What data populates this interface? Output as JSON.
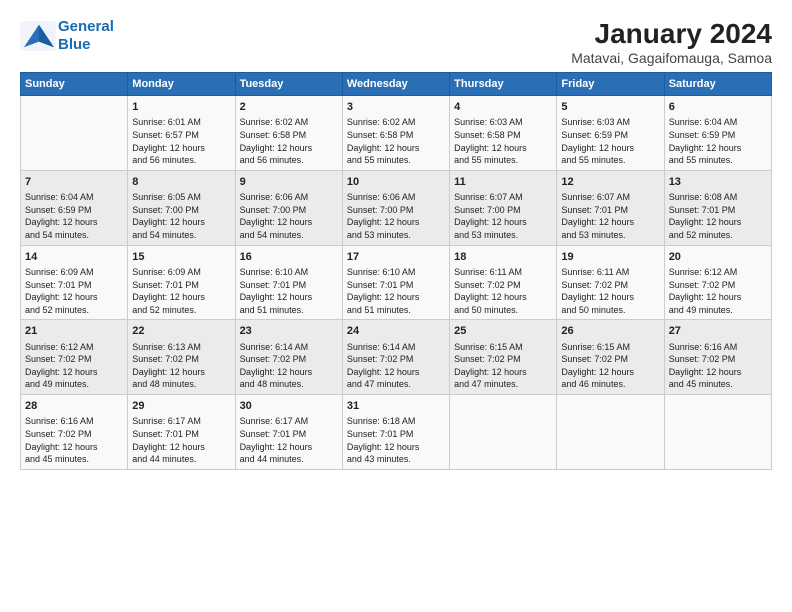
{
  "logo": {
    "line1": "General",
    "line2": "Blue"
  },
  "title": "January 2024",
  "subtitle": "Matavai, Gagaifomauga, Samoa",
  "columns": [
    "Sunday",
    "Monday",
    "Tuesday",
    "Wednesday",
    "Thursday",
    "Friday",
    "Saturday"
  ],
  "weeks": [
    [
      {
        "day": "",
        "info": ""
      },
      {
        "day": "1",
        "info": "Sunrise: 6:01 AM\nSunset: 6:57 PM\nDaylight: 12 hours\nand 56 minutes."
      },
      {
        "day": "2",
        "info": "Sunrise: 6:02 AM\nSunset: 6:58 PM\nDaylight: 12 hours\nand 56 minutes."
      },
      {
        "day": "3",
        "info": "Sunrise: 6:02 AM\nSunset: 6:58 PM\nDaylight: 12 hours\nand 55 minutes."
      },
      {
        "day": "4",
        "info": "Sunrise: 6:03 AM\nSunset: 6:58 PM\nDaylight: 12 hours\nand 55 minutes."
      },
      {
        "day": "5",
        "info": "Sunrise: 6:03 AM\nSunset: 6:59 PM\nDaylight: 12 hours\nand 55 minutes."
      },
      {
        "day": "6",
        "info": "Sunrise: 6:04 AM\nSunset: 6:59 PM\nDaylight: 12 hours\nand 55 minutes."
      }
    ],
    [
      {
        "day": "7",
        "info": "Sunrise: 6:04 AM\nSunset: 6:59 PM\nDaylight: 12 hours\nand 54 minutes."
      },
      {
        "day": "8",
        "info": "Sunrise: 6:05 AM\nSunset: 7:00 PM\nDaylight: 12 hours\nand 54 minutes."
      },
      {
        "day": "9",
        "info": "Sunrise: 6:06 AM\nSunset: 7:00 PM\nDaylight: 12 hours\nand 54 minutes."
      },
      {
        "day": "10",
        "info": "Sunrise: 6:06 AM\nSunset: 7:00 PM\nDaylight: 12 hours\nand 53 minutes."
      },
      {
        "day": "11",
        "info": "Sunrise: 6:07 AM\nSunset: 7:00 PM\nDaylight: 12 hours\nand 53 minutes."
      },
      {
        "day": "12",
        "info": "Sunrise: 6:07 AM\nSunset: 7:01 PM\nDaylight: 12 hours\nand 53 minutes."
      },
      {
        "day": "13",
        "info": "Sunrise: 6:08 AM\nSunset: 7:01 PM\nDaylight: 12 hours\nand 52 minutes."
      }
    ],
    [
      {
        "day": "14",
        "info": "Sunrise: 6:09 AM\nSunset: 7:01 PM\nDaylight: 12 hours\nand 52 minutes."
      },
      {
        "day": "15",
        "info": "Sunrise: 6:09 AM\nSunset: 7:01 PM\nDaylight: 12 hours\nand 52 minutes."
      },
      {
        "day": "16",
        "info": "Sunrise: 6:10 AM\nSunset: 7:01 PM\nDaylight: 12 hours\nand 51 minutes."
      },
      {
        "day": "17",
        "info": "Sunrise: 6:10 AM\nSunset: 7:01 PM\nDaylight: 12 hours\nand 51 minutes."
      },
      {
        "day": "18",
        "info": "Sunrise: 6:11 AM\nSunset: 7:02 PM\nDaylight: 12 hours\nand 50 minutes."
      },
      {
        "day": "19",
        "info": "Sunrise: 6:11 AM\nSunset: 7:02 PM\nDaylight: 12 hours\nand 50 minutes."
      },
      {
        "day": "20",
        "info": "Sunrise: 6:12 AM\nSunset: 7:02 PM\nDaylight: 12 hours\nand 49 minutes."
      }
    ],
    [
      {
        "day": "21",
        "info": "Sunrise: 6:12 AM\nSunset: 7:02 PM\nDaylight: 12 hours\nand 49 minutes."
      },
      {
        "day": "22",
        "info": "Sunrise: 6:13 AM\nSunset: 7:02 PM\nDaylight: 12 hours\nand 48 minutes."
      },
      {
        "day": "23",
        "info": "Sunrise: 6:14 AM\nSunset: 7:02 PM\nDaylight: 12 hours\nand 48 minutes."
      },
      {
        "day": "24",
        "info": "Sunrise: 6:14 AM\nSunset: 7:02 PM\nDaylight: 12 hours\nand 47 minutes."
      },
      {
        "day": "25",
        "info": "Sunrise: 6:15 AM\nSunset: 7:02 PM\nDaylight: 12 hours\nand 47 minutes."
      },
      {
        "day": "26",
        "info": "Sunrise: 6:15 AM\nSunset: 7:02 PM\nDaylight: 12 hours\nand 46 minutes."
      },
      {
        "day": "27",
        "info": "Sunrise: 6:16 AM\nSunset: 7:02 PM\nDaylight: 12 hours\nand 45 minutes."
      }
    ],
    [
      {
        "day": "28",
        "info": "Sunrise: 6:16 AM\nSunset: 7:02 PM\nDaylight: 12 hours\nand 45 minutes."
      },
      {
        "day": "29",
        "info": "Sunrise: 6:17 AM\nSunset: 7:01 PM\nDaylight: 12 hours\nand 44 minutes."
      },
      {
        "day": "30",
        "info": "Sunrise: 6:17 AM\nSunset: 7:01 PM\nDaylight: 12 hours\nand 44 minutes."
      },
      {
        "day": "31",
        "info": "Sunrise: 6:18 AM\nSunset: 7:01 PM\nDaylight: 12 hours\nand 43 minutes."
      },
      {
        "day": "",
        "info": ""
      },
      {
        "day": "",
        "info": ""
      },
      {
        "day": "",
        "info": ""
      }
    ]
  ]
}
